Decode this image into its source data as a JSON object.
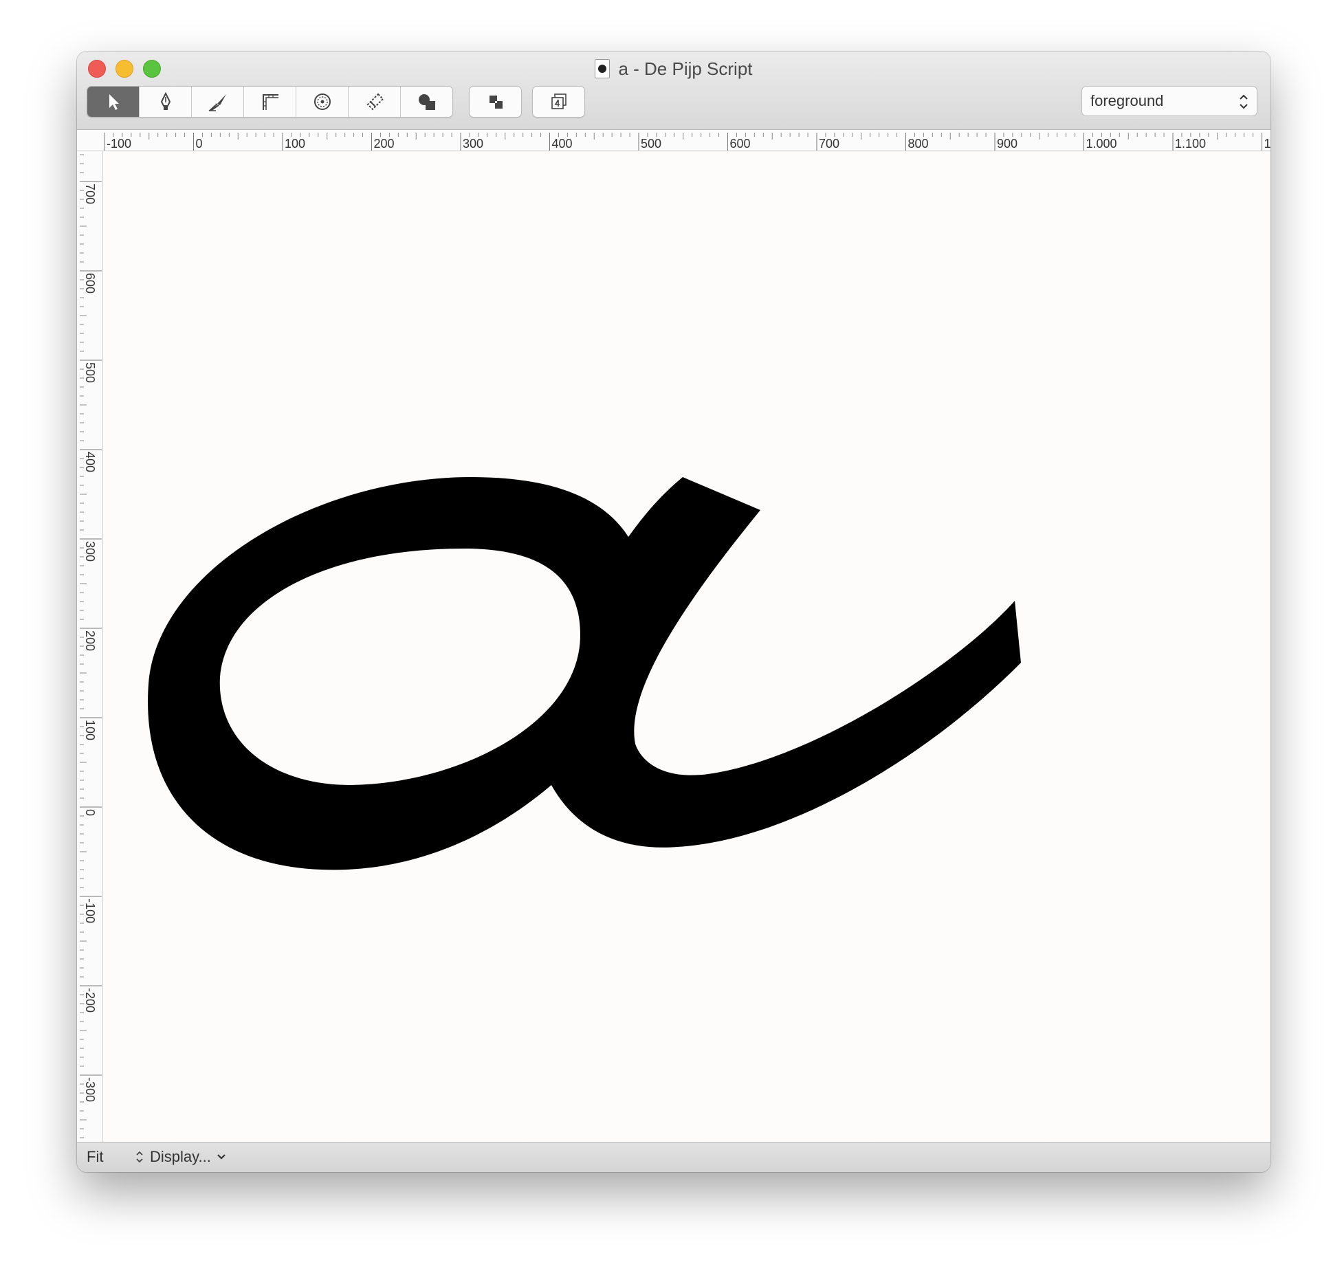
{
  "window": {
    "title": "a - De Pijp Script"
  },
  "toolbar": {
    "tools": [
      {
        "icon": "pointer-icon"
      },
      {
        "icon": "pen-icon"
      },
      {
        "icon": "knife-icon"
      },
      {
        "icon": "measure-icon"
      },
      {
        "icon": "zoom-icon"
      },
      {
        "icon": "eraser-icon"
      },
      {
        "icon": "shapes-icon"
      }
    ],
    "active_tool": 0,
    "extra_buttons": [
      {
        "icon": "layers-order-icon"
      },
      {
        "icon": "add-reference-icon"
      }
    ],
    "layer_select": "foreground"
  },
  "rulers": {
    "horizontal_labels": [
      "-100",
      "0",
      "100",
      "200",
      "300",
      "400",
      "500",
      "600",
      "700",
      "800",
      "900",
      "1.000",
      "1.100",
      "1."
    ],
    "vertical_labels": [
      "700",
      "600",
      "500",
      "400",
      "300",
      "200",
      "100",
      "0",
      "-100",
      "-200",
      "-300"
    ]
  },
  "glyph": {
    "name": "a",
    "fill": "#000000"
  },
  "statusbar": {
    "zoom": "Fit",
    "display_menu": "Display..."
  },
  "colors": {
    "canvas_bg": "#fdfcfa",
    "active_tool_bg": "#6a6a6a",
    "close": "#ee5c55",
    "minimize": "#f7bd30",
    "zoom": "#5ac43f"
  }
}
